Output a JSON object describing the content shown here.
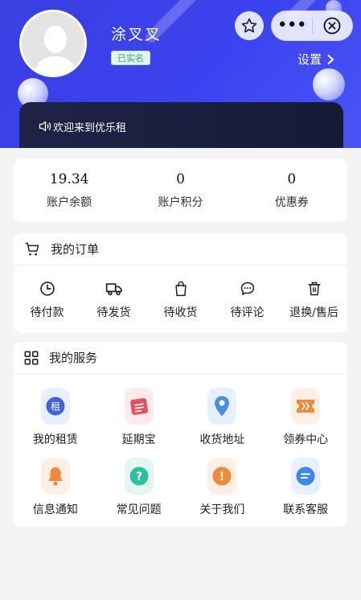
{
  "profile": {
    "username": "涂叉叉",
    "verified_badge": "已实名",
    "settings_label": "设置"
  },
  "notice": {
    "text": "欢迎来到优乐租"
  },
  "stats": [
    {
      "value": "19.34",
      "label": "账户余额"
    },
    {
      "value": "0",
      "label": "账户积分"
    },
    {
      "value": "0",
      "label": "优惠券"
    }
  ],
  "orders": {
    "title": "我的订单",
    "items": [
      {
        "label": "待付款",
        "icon": "clock-icon"
      },
      {
        "label": "待发货",
        "icon": "truck-icon"
      },
      {
        "label": "待收货",
        "icon": "bag-icon"
      },
      {
        "label": "待评论",
        "icon": "comment-icon"
      },
      {
        "label": "退换/售后",
        "icon": "trash-icon"
      }
    ]
  },
  "services": {
    "title": "我的服务",
    "items": [
      {
        "label": "我的租赁",
        "icon": "rent-icon",
        "glyph": "租",
        "color": "#3f63d8"
      },
      {
        "label": "延期宝",
        "icon": "extend-icon",
        "glyph": "",
        "color": "#ea4d5c"
      },
      {
        "label": "收货地址",
        "icon": "location-pin-icon",
        "glyph": "",
        "color": "#4a8fe0"
      },
      {
        "label": "领券中心",
        "icon": "coupon-icon",
        "glyph": "",
        "color": "#f08a3a"
      },
      {
        "label": "信息通知",
        "icon": "bell-icon",
        "glyph": "",
        "color": "#f08a3a"
      },
      {
        "label": "常见问题",
        "icon": "question-icon",
        "glyph": "?",
        "color": "#2fbfa0"
      },
      {
        "label": "关于我们",
        "icon": "info-icon",
        "glyph": "!",
        "color": "#f08a3a"
      },
      {
        "label": "联系客服",
        "icon": "customer-service-icon",
        "glyph": "",
        "color": "#3d86ec"
      }
    ]
  }
}
